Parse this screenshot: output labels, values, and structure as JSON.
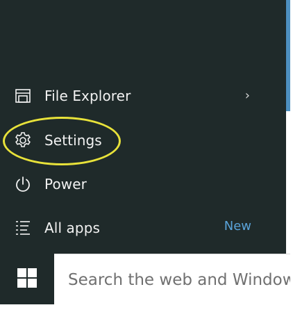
{
  "start_menu": {
    "items": [
      {
        "label": "File Explorer",
        "icon": "file-explorer-icon",
        "has_submenu": true
      },
      {
        "label": "Settings",
        "icon": "gear-icon",
        "highlighted": true
      },
      {
        "label": "Power",
        "icon": "power-icon"
      },
      {
        "label": "All apps",
        "icon": "all-apps-icon",
        "badge": "New"
      }
    ],
    "chevron": "›"
  },
  "taskbar": {
    "start_icon": "windows-logo-icon",
    "search_placeholder": "Search the web and Windows"
  },
  "colors": {
    "menu_background": "#1f2a2a",
    "text": "#f2f2f2",
    "accent_new": "#5aa3d9",
    "highlight_ring": "#e8e23a"
  }
}
